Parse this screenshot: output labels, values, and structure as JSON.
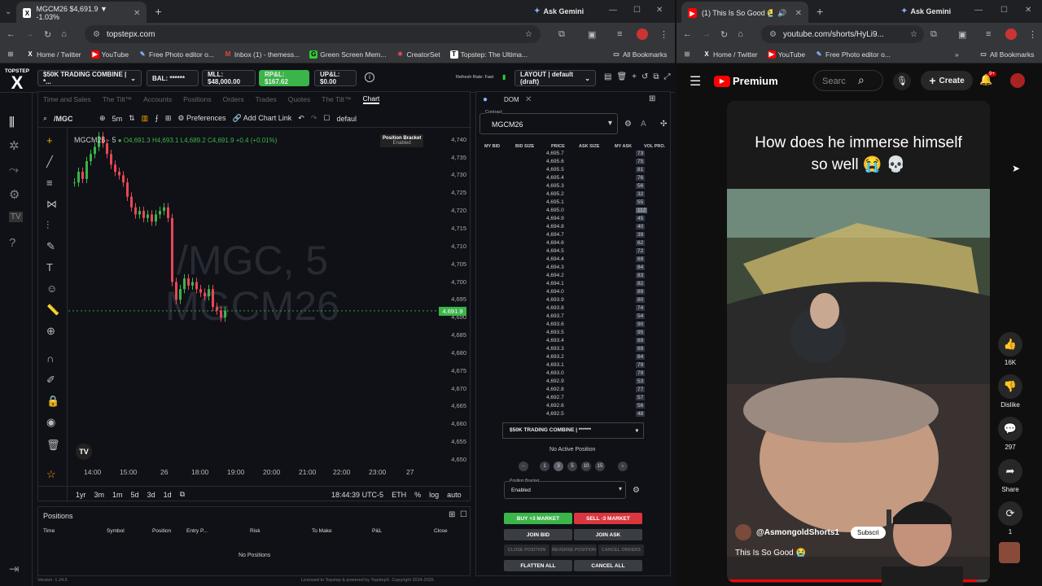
{
  "left_browser": {
    "tab_title": "MGCM26 $4,691.9 ▼ -1.03%",
    "ask_gemini": "Ask Gemini",
    "url": "topstepx.com",
    "bookmarks": [
      "Home / Twitter",
      "YouTube",
      "Free Photo editor o...",
      "Inbox (1) - themess...",
      "Green Screen Mem...",
      "CreatorSet",
      "Topstep: The Ultima..."
    ],
    "all_bookmarks": "All Bookmarks"
  },
  "topstep": {
    "logo_text": "TOPSTEP",
    "logo_letter": "X",
    "account": "$50K TRADING COMBINE | *...",
    "bal": "BAL: ******",
    "mll": "MLL: $48,000.00",
    "rpl": "RP&L: $167.62",
    "upl": "UP&L: $0.00",
    "refresh": "Refresh Rate: Fast",
    "layout": "LAYOUT | default (draft)"
  },
  "chart": {
    "tabs": [
      "Time and Sales",
      "The Tilt™",
      "Accounts",
      "Positions",
      "Orders",
      "Trades",
      "Quotes",
      "The Tilt™",
      "Chart"
    ],
    "symbol": "/MGC",
    "timeframe": "5m",
    "preferences": "Preferences",
    "add_chart_link": "Add Chart Link",
    "default": "defaul",
    "legend_symbol": "MGCM26 · 5",
    "ohlc": "O4,691.3 H4,693.1 L4,689.2 C4,691.9 +0.4 (+0.01%)",
    "bracket_title": "Position Bracket",
    "bracket_status": "Enabled",
    "watermark1": "/MGC, 5",
    "watermark2": "MGCM26",
    "last_price": "4,691.9",
    "y_ticks": [
      "4,740",
      "4,735",
      "4,730",
      "4,725",
      "4,720",
      "4,715",
      "4,710",
      "4,705",
      "4,700",
      "4,695",
      "4,690",
      "4,685",
      "4,680",
      "4,675",
      "4,670",
      "4,665",
      "4,660",
      "4,655",
      "4,650"
    ],
    "x_ticks": [
      "14:00",
      "15:00",
      "26",
      "18:00",
      "19:00",
      "20:00",
      "21:00",
      "22:00",
      "23:00",
      "27"
    ],
    "ranges": [
      "1yr",
      "3m",
      "1m",
      "5d",
      "3d",
      "1d"
    ],
    "time": "18:44:39 UTC-5",
    "session": "ETH",
    "pct": "%",
    "log": "log",
    "auto": "auto"
  },
  "chart_data": {
    "type": "candlestick",
    "ylim": [
      4650,
      4742
    ],
    "points": [
      4728,
      4731,
      4729,
      4734,
      4736,
      4738,
      4741,
      4739,
      4736,
      4733,
      4731,
      4730,
      4728,
      4724,
      4721,
      4719,
      4720,
      4718,
      4719,
      4717,
      4719,
      4720,
      4721,
      4718,
      4700,
      4695,
      4698,
      4701,
      4699,
      4700,
      4698,
      4697,
      4696,
      4698,
      4693,
      4692,
      4690,
      4691.9
    ]
  },
  "positions": {
    "title": "Positions",
    "headers": [
      "Time",
      "Symbol",
      "Position",
      "Entry P...",
      "Risk",
      "To Make",
      "P&L",
      "Close"
    ],
    "empty": "No Positions"
  },
  "dom": {
    "title": "DOM",
    "contract_label": "Contract",
    "contract": "MGCM26",
    "headers": [
      "MY BID",
      "BID SIZE",
      "PRICE",
      "ASK SIZE",
      "MY ASK",
      "VOL PRO."
    ],
    "rows": [
      [
        "4,695.7",
        "73"
      ],
      [
        "4,695.6",
        "75"
      ],
      [
        "4,695.5",
        "81"
      ],
      [
        "4,695.4",
        "76"
      ],
      [
        "4,695.3",
        "56"
      ],
      [
        "4,695.2",
        "32"
      ],
      [
        "4,695.1",
        "55"
      ],
      [
        "4,695.0",
        "112"
      ],
      [
        "4,694.9",
        "45"
      ],
      [
        "4,694.8",
        "40"
      ],
      [
        "4,694.7",
        "39"
      ],
      [
        "4,694.6",
        "62"
      ],
      [
        "4,694.5",
        "72"
      ],
      [
        "4,694.4",
        "69"
      ],
      [
        "4,694.3",
        "84"
      ],
      [
        "4,694.2",
        "83"
      ],
      [
        "4,694.1",
        "82"
      ],
      [
        "4,694.0",
        "89"
      ],
      [
        "4,693.9",
        "80"
      ],
      [
        "4,693.8",
        "74"
      ],
      [
        "4,693.7",
        "54"
      ],
      [
        "4,693.6",
        "90"
      ],
      [
        "4,693.5",
        "95"
      ],
      [
        "4,693.4",
        "69"
      ],
      [
        "4,693.3",
        "69"
      ],
      [
        "4,693.2",
        "84"
      ],
      [
        "4,693.1",
        "79"
      ],
      [
        "4,693.0",
        "79"
      ],
      [
        "4,692.9",
        "53"
      ],
      [
        "4,692.8",
        "77"
      ],
      [
        "4,692.7",
        "57"
      ],
      [
        "4,692.6",
        "56"
      ],
      [
        "4,692.5",
        "48"
      ]
    ],
    "account": "$50K TRADING COMBINE | ******",
    "no_position": "No Active Position",
    "qty": [
      "1",
      "3",
      "5",
      "10",
      "15"
    ],
    "bracket_label": "Position Bracket",
    "bracket_value": "Enabled",
    "buy": "BUY +3 MARKET",
    "sell": "SELL -3 MARKET",
    "join_bid": "JOIN BID",
    "join_ask": "JOIN ASK",
    "close_pos": "CLOSE POSITION",
    "reverse": "REVERSE POSITION",
    "cancel_orders": "CANCEL ORDERS",
    "flatten": "FLATTEN ALL",
    "cancel_all": "CANCEL ALL"
  },
  "footer": {
    "version": "Version: 1.24.5",
    "license": "Licensed to Topstep & powered by TopstepX. Copyright 2024-2026"
  },
  "right_browser": {
    "tab_title": "(1) This Is So Good 😭 - Yo",
    "ask_gemini": "Ask Gemini",
    "url": "youtube.com/shorts/HyLi9...",
    "bookmarks": [
      "Home / Twitter",
      "YouTube",
      "Free Photo editor o..."
    ],
    "all_bookmarks": "All Bookmarks"
  },
  "youtube": {
    "brand": "Premium",
    "search_placeholder": "Searc",
    "create": "Create",
    "notif_count": "9+",
    "caption": "How does he immerse himself so well 😭 💀",
    "channel": "@AsmongoldShorts1",
    "subscribe": "Subscri",
    "video_title": "This Is So Good 😭",
    "likes": "16K",
    "dislike": "Dislike",
    "comments": "297",
    "share": "Share",
    "remix": "1"
  }
}
